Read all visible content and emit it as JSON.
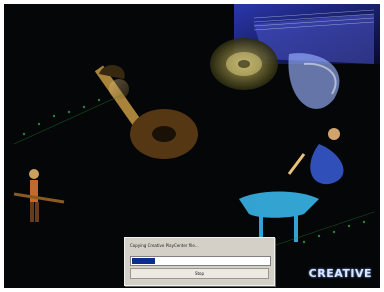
{
  "brand": {
    "logo_text": "CREATIVE"
  },
  "install_dialog": {
    "message": "Copying Creative PlayCenter file...",
    "progress_fraction": 0.17,
    "cancel_label": "Stop"
  },
  "colors": {
    "background": "#050608",
    "progress_fill": "#0a2e8c",
    "dialog_face": "#d4d0c8"
  }
}
